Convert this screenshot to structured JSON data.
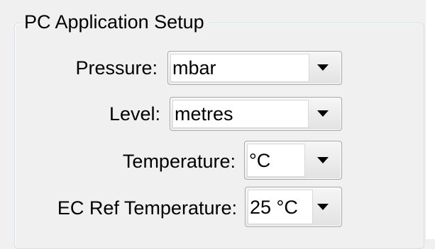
{
  "group": {
    "title": "PC Application Setup"
  },
  "fields": {
    "pressure": {
      "label": "Pressure:",
      "value": "mbar"
    },
    "level": {
      "label": "Level:",
      "value": "metres"
    },
    "temperature": {
      "label": "Temperature:",
      "value": "°C"
    },
    "ec_ref_temperature": {
      "label": "EC Ref Temperature:",
      "value": "25 °C"
    }
  }
}
